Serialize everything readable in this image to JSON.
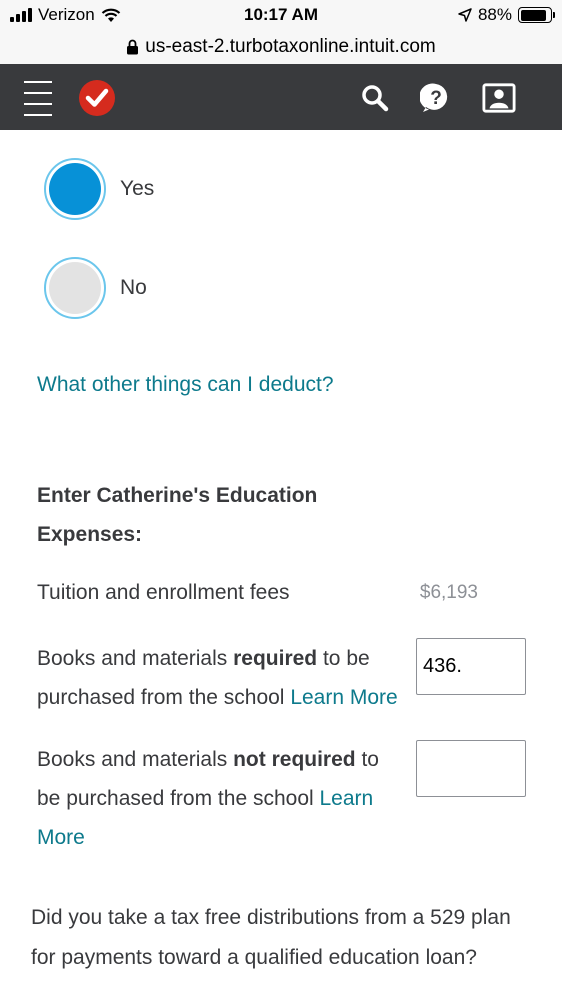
{
  "status_bar": {
    "carrier": "Verizon",
    "time": "10:17 AM",
    "battery_percent": "88%",
    "battery_level": 0.88,
    "icons": [
      "signal-icon",
      "wifi-icon",
      "location-arrow-icon",
      "battery-icon"
    ]
  },
  "browser": {
    "url": "us-east-2.turbotaxonline.intuit.com"
  },
  "header": {
    "icons": [
      "hamburger-menu-icon",
      "turbotax-logo-icon",
      "search-icon",
      "help-icon",
      "profile-icon"
    ]
  },
  "radio_options": [
    {
      "label": "Yes",
      "selected": true
    },
    {
      "label": "No",
      "selected": false
    }
  ],
  "links": {
    "deduct": "What other things can I deduct?"
  },
  "education": {
    "title": "Enter Catherine's Education Expenses:",
    "tuition_label": "Tuition and enrollment fees",
    "tuition_value": "$6,193",
    "books_required": {
      "prefix": "Books and materials ",
      "bold": "required",
      "suffix": " to be purchased from the school ",
      "link": "Learn More",
      "value": "436.",
      "placeholder": ""
    },
    "books_not_required": {
      "prefix": "Books and materials ",
      "bold": "not required",
      "suffix": " to be purchased from the school ",
      "link": "Learn More",
      "value": "",
      "placeholder": ""
    }
  },
  "question": "Did you take a tax free distributions from a 529 plan for payments toward a qualified education loan?",
  "colors": {
    "accent": "#0d7a8c",
    "radio_selected": "#0791d7",
    "radio_unselected": "#e3e3e3",
    "radio_border": "#6bc6ec",
    "header_bg": "#393a3d",
    "logo_red": "#d52b1e"
  }
}
